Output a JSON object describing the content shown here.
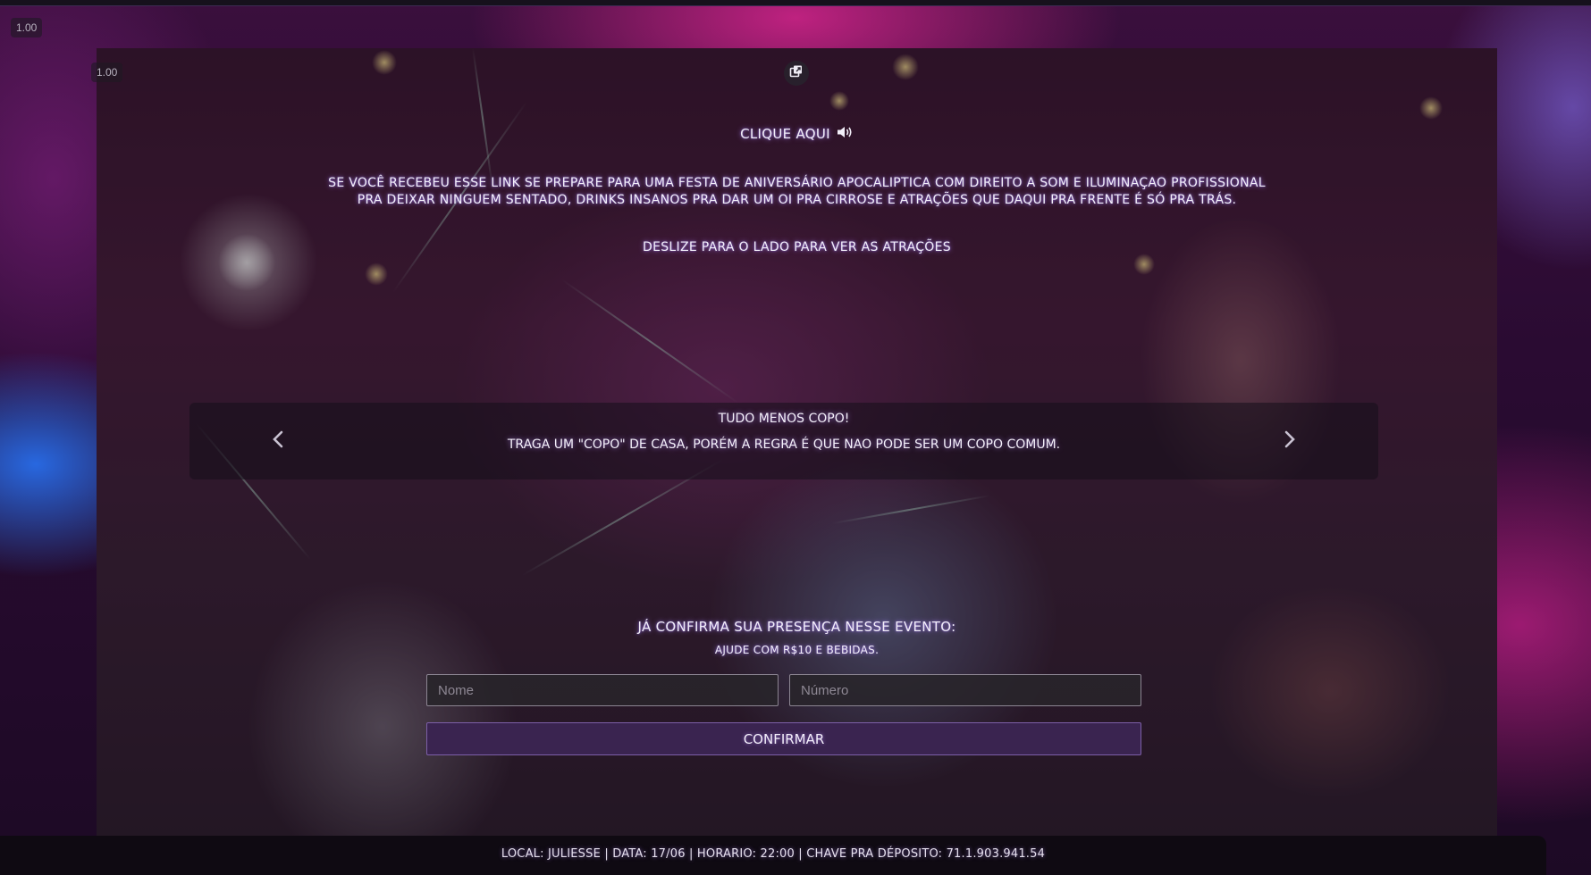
{
  "zoom": {
    "outer": "1.00",
    "inner": "1.00"
  },
  "icons": {
    "popout": "popout-window-icon",
    "speaker": "speaker-volume-icon",
    "prev": "chevron-left-icon",
    "next": "chevron-right-icon"
  },
  "hero": {
    "click_here": "CLIQUE AQUI",
    "invite_line_1": "SE VOCÊ RECEBEU ESSE LINK SE PREPARE PARA UMA FESTA DE ANIVERSÁRIO APOCALIPTICA COM DIREITO A SOM E ILUMINAÇAO PROFISSIONAL",
    "invite_line_2": "PRA DEIXAR NINGUEM SENTADO, DRINKS INSANOS PRA DAR UM OI PRA CIRROSE E ATRAÇÕES QUE DAQUI PRA FRENTE É SÓ PRA TRÁS.",
    "swipe_hint": "DESLIZE PARA O LADO PARA VER AS ATRAÇÕES"
  },
  "carousel": {
    "title": "TUDO MENOS COPO!",
    "description": "TRAGA UM \"COPO\" DE CASA, PORÉM A REGRA É QUE NAO PODE SER UM COPO COMUM."
  },
  "confirm": {
    "title": "JÁ CONFIRMA SUA PRESENÇA NESSE EVENTO:",
    "subtitle": "AJUDE COM R$10 E BEBIDAS.",
    "name_placeholder": "Nome",
    "number_placeholder": "Número",
    "button_label": "CONFIRMAR"
  },
  "footer": {
    "text": "LOCAL: JULIESSE | DATA: 17/06 | HORARIO: 22:00 | CHAVE PRA DÉPOSITO: 71.1.903.941.54"
  },
  "colors": {
    "accent": "#3a2450",
    "glow": "#b48cff",
    "footer_bg": "#0f0a12"
  }
}
